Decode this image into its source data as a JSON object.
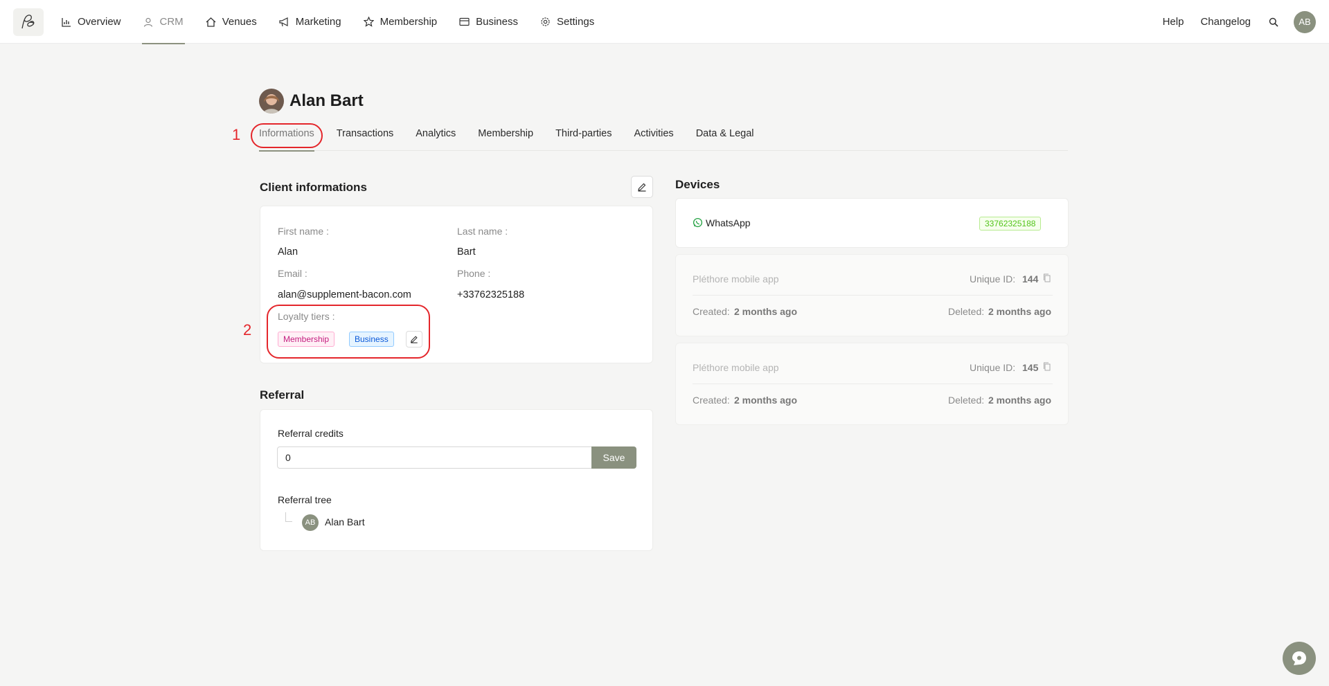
{
  "nav": {
    "items": [
      {
        "label": "Overview",
        "icon": "chart-icon"
      },
      {
        "label": "CRM",
        "icon": "user-icon",
        "active": true
      },
      {
        "label": "Venues",
        "icon": "home-icon"
      },
      {
        "label": "Marketing",
        "icon": "megaphone-icon"
      },
      {
        "label": "Membership",
        "icon": "star-icon"
      },
      {
        "label": "Business",
        "icon": "card-icon"
      },
      {
        "label": "Settings",
        "icon": "gear-icon"
      }
    ],
    "help": "Help",
    "changelog": "Changelog",
    "avatar_initials": "AB"
  },
  "profile": {
    "name": "Alan Bart"
  },
  "tabs": [
    "Informations",
    "Transactions",
    "Analytics",
    "Membership",
    "Third-parties",
    "Activities",
    "Data & Legal"
  ],
  "annotations": {
    "one": "1",
    "two": "2"
  },
  "client": {
    "title": "Client informations",
    "first_name_label": "First name :",
    "first_name": "Alan",
    "last_name_label": "Last name :",
    "last_name": "Bart",
    "email_label": "Email :",
    "email": "alan@supplement-bacon.com",
    "phone_label": "Phone :",
    "phone": "+33762325188",
    "loyalty_label": "Loyalty tiers :",
    "tiers": [
      "Membership",
      "Business"
    ]
  },
  "referral": {
    "title": "Referral",
    "credits_label": "Referral credits",
    "credits_value": "0",
    "save_label": "Save",
    "tree_label": "Referral tree",
    "tree_avatar": "AB",
    "tree_name": "Alan Bart"
  },
  "devices": {
    "title": "Devices",
    "whatsapp_label": "WhatsApp",
    "whatsapp_number": "33762325188",
    "apps": [
      {
        "name": "Pléthore mobile app",
        "unique_label": "Unique ID:",
        "unique_id": "144",
        "created_label": "Created:",
        "created": "2 months ago",
        "deleted_label": "Deleted:",
        "deleted": "2 months ago"
      },
      {
        "name": "Pléthore mobile app",
        "unique_label": "Unique ID:",
        "unique_id": "145",
        "created_label": "Created:",
        "created": "2 months ago",
        "deleted_label": "Deleted:",
        "deleted": "2 months ago"
      }
    ]
  },
  "colors": {
    "accent": "#8a917f",
    "annotation": "#e4262b"
  }
}
